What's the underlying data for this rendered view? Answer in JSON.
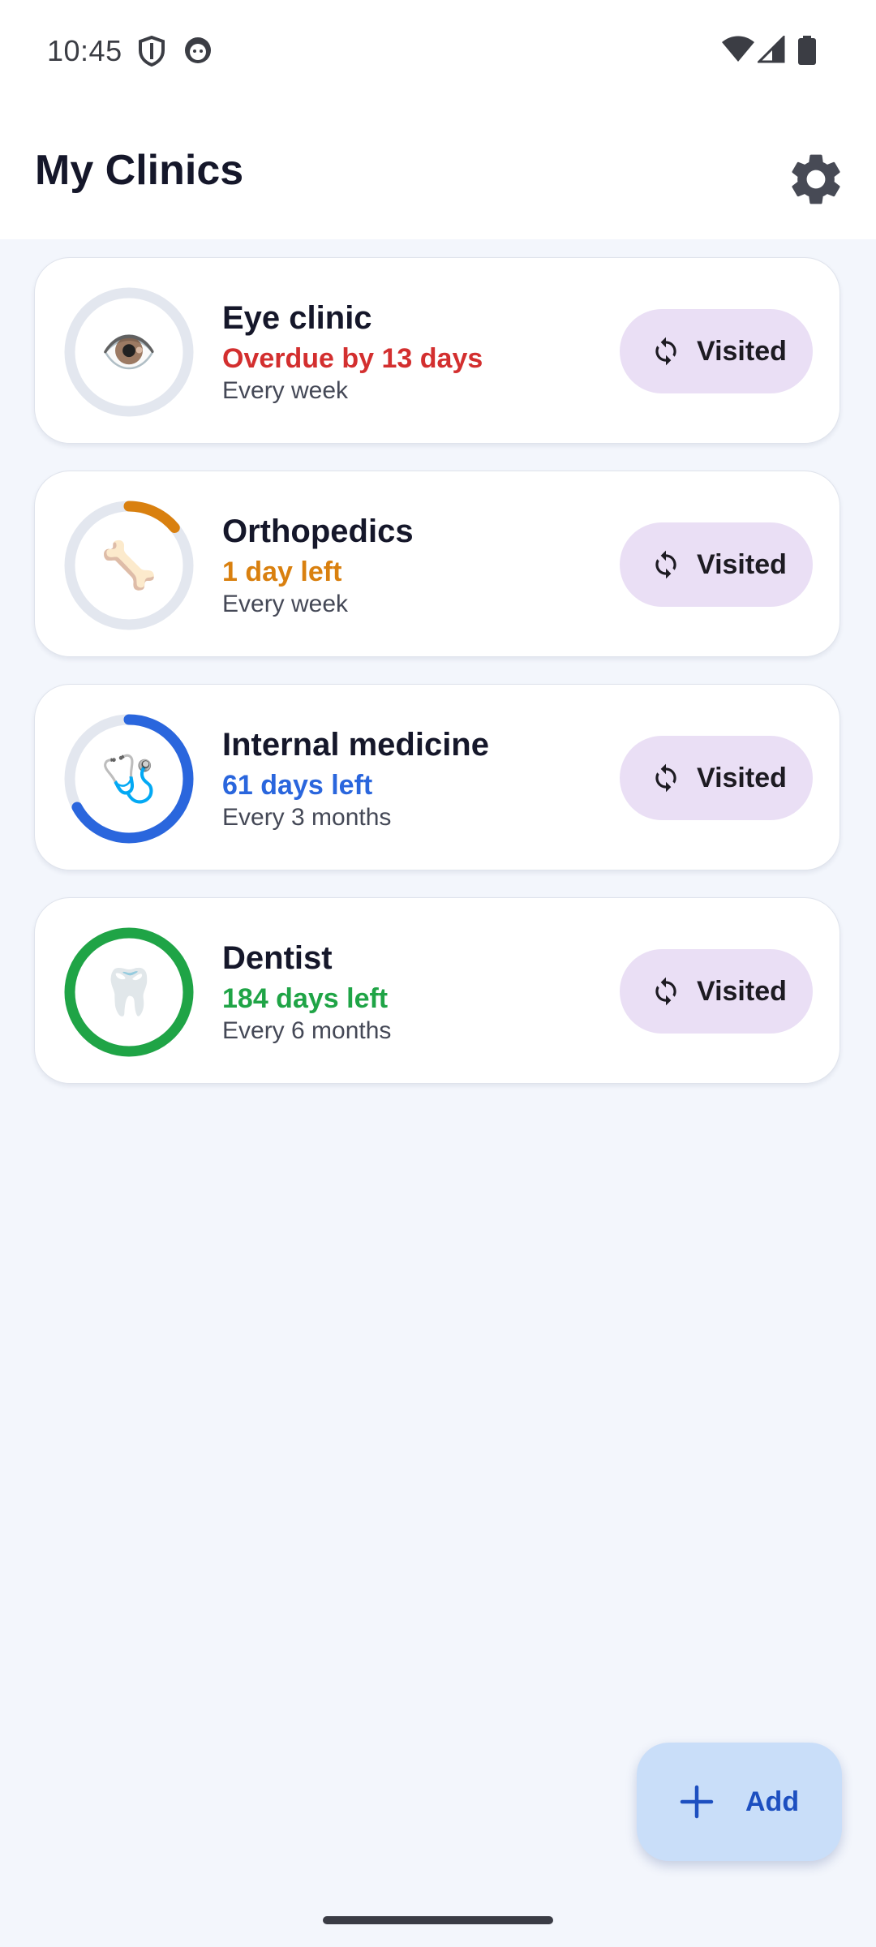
{
  "status_bar": {
    "time": "10:45",
    "left_icons": [
      "shield-icon",
      "notification-face-icon"
    ],
    "right_icons": [
      "wifi-icon",
      "signal-icon",
      "battery-icon"
    ]
  },
  "header": {
    "title": "My Clinics",
    "settings_icon": "gear-icon"
  },
  "clinics": [
    {
      "name": "Eye clinic",
      "status": "Overdue by 13 days",
      "frequency": "Every week",
      "emoji": "👁️",
      "status_color": "#d32f2f",
      "ring_color": "#e3e7ef",
      "progress": 0,
      "button_label": "Visited"
    },
    {
      "name": "Orthopedics",
      "status": "1 day left",
      "frequency": "Every week",
      "emoji": "🦴",
      "status_color": "#d9800f",
      "ring_color": "#d9800f",
      "progress": 0.14,
      "button_label": "Visited"
    },
    {
      "name": "Internal medicine",
      "status": "61 days left",
      "frequency": "Every 3 months",
      "emoji": "🩺",
      "status_color": "#2a66dd",
      "ring_color": "#2a66dd",
      "progress": 0.67,
      "button_label": "Visited"
    },
    {
      "name": "Dentist",
      "status": "184 days left",
      "frequency": "Every 6 months",
      "emoji": "🦷",
      "status_color": "#1fa446",
      "ring_color": "#1fa446",
      "progress": 1.0,
      "button_label": "Visited"
    }
  ],
  "fab": {
    "label": "Add",
    "icon": "plus-icon"
  },
  "colors": {
    "ring_track": "#e3e7ef",
    "visited_button_bg": "#eadff5",
    "fab_bg": "#c9def9",
    "fab_text": "#1d4fc0"
  }
}
